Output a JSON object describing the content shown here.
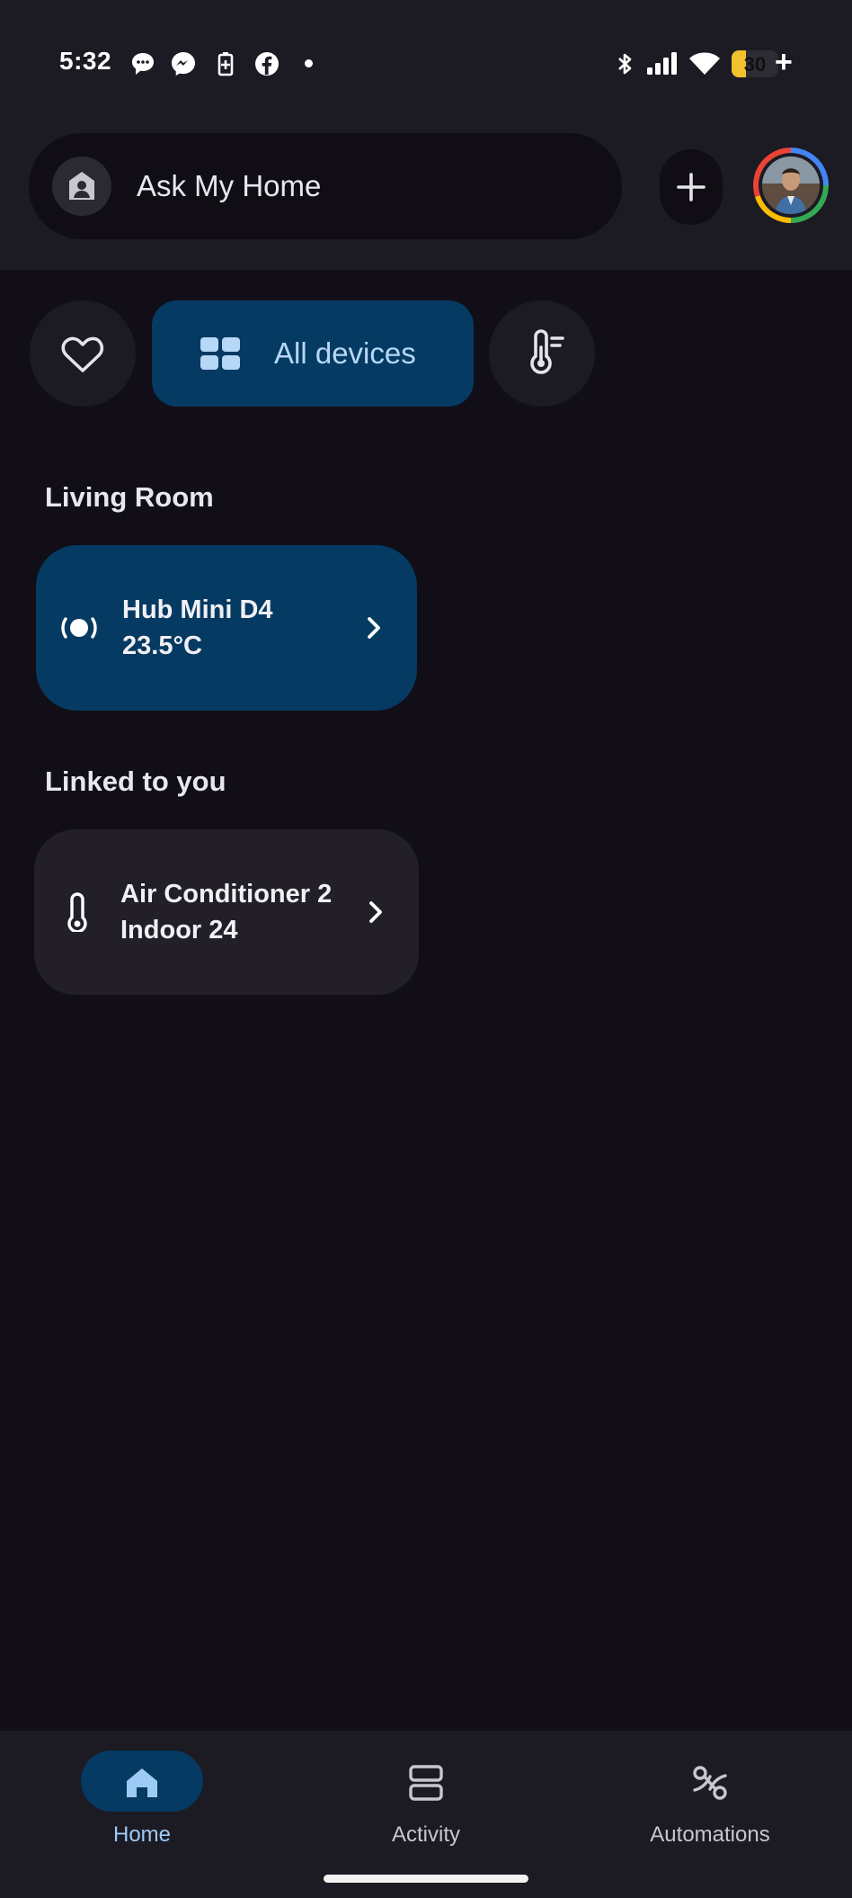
{
  "status_bar": {
    "time": "5:32",
    "battery_level": "30",
    "battery_plus": "+",
    "battery_fraction": 0.3,
    "icons": [
      "chat-bubble-icon",
      "messenger-icon",
      "battery-saver-icon",
      "facebook-icon",
      "dot-icon",
      "bluetooth-icon",
      "signal-icon",
      "wifi-icon"
    ]
  },
  "header": {
    "search_label": "Ask My Home",
    "add_icon": "plus-icon",
    "avatar_icon": "profile-photo"
  },
  "filters": {
    "favorites_icon": "heart-icon",
    "active_label": "All devices",
    "active_icon": "grid-icon",
    "climate_icon": "thermometer-icon"
  },
  "sections": [
    {
      "title": "Living Room",
      "devices": [
        {
          "name": "Hub Mini D4",
          "value": "23.5°C",
          "icon": "hub-icon"
        }
      ]
    },
    {
      "title": "Linked to you",
      "devices": [
        {
          "name": "Air Conditioner 2",
          "value": "Indoor 24",
          "icon": "thermometer-icon"
        }
      ]
    }
  ],
  "bottom_nav": {
    "items": [
      {
        "label": "Home",
        "icon": "home-icon",
        "active": true
      },
      {
        "label": "Activity",
        "icon": "activity-icon",
        "active": false
      },
      {
        "label": "Automations",
        "icon": "automations-icon",
        "active": false
      }
    ]
  },
  "colors": {
    "background": "#110e18",
    "surface": "#1c1a23",
    "accent": "#053a62",
    "accent_text": "#9ecbf6"
  }
}
